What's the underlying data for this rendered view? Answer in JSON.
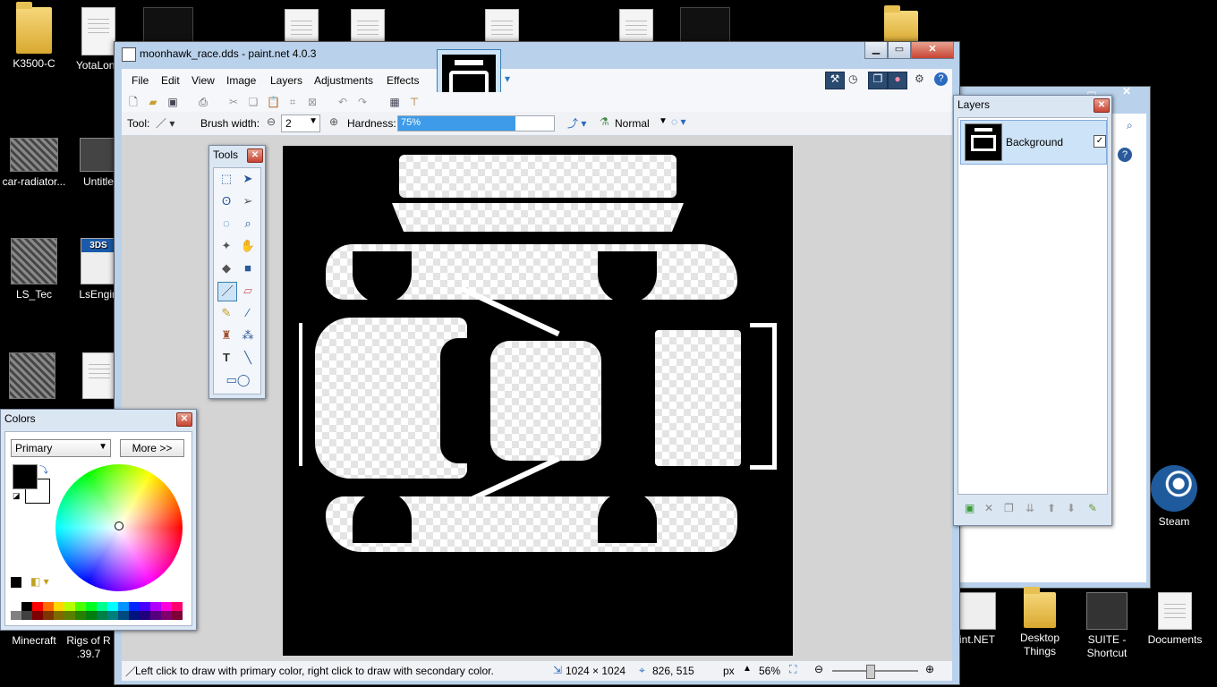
{
  "desktop": {
    "icons_left": [
      {
        "label": "K3500-C",
        "kind": "folder"
      },
      {
        "label": "YotaLong",
        "kind": "doc"
      },
      {
        "label": "car-radiator...",
        "kind": "thumb"
      },
      {
        "label": "Untitle",
        "kind": "imgicon"
      },
      {
        "label": "LS_Tec",
        "kind": "thumb"
      },
      {
        "label": "LsEngin",
        "kind": "3ds"
      },
      {
        "label": "Minecraft",
        "kind": "app"
      },
      {
        "label": "Rigs of R\n.39.7",
        "kind": "app"
      }
    ],
    "rigs_label_line1": "Rigs of R",
    "rigs_label_line2": ".39.7",
    "icons_right": [
      {
        "label": "Steam"
      },
      {
        "label": "int.NET"
      },
      {
        "label": "Desktop Things"
      },
      {
        "label": "SUITE - Shortcut"
      },
      {
        "label": "Documents"
      }
    ],
    "badge_3ds": "3DS"
  },
  "window": {
    "title": "moonhawk_race.dds - paint.net 4.0.3",
    "menu": [
      "File",
      "Edit",
      "View",
      "Image",
      "Layers",
      "Adjustments",
      "Effects"
    ],
    "tool_label": "Tool:",
    "brush_width_label": "Brush width:",
    "brush_width_value": "2",
    "hardness_label": "Hardness:",
    "hardness_value": "75%",
    "hardness_fraction": 0.75,
    "blend_mode": "Normal"
  },
  "status": {
    "hint": "Left click to draw with primary color, right click to draw with secondary color.",
    "image_size": "1024 × 1024",
    "cursor_pos": "826, 515",
    "unit": "px",
    "zoom": "56%"
  },
  "tools_panel": {
    "title": "Tools"
  },
  "colors_panel": {
    "title": "Colors",
    "mode": "Primary",
    "more_button": "More >>",
    "primary_color": "#000000",
    "secondary_color": "#ffffff"
  },
  "layers_panel": {
    "title": "Layers",
    "layers": [
      {
        "name": "Background",
        "visible": true
      }
    ]
  },
  "palette": [
    "#ffffff",
    "#000000",
    "#ff0000",
    "#ff6a00",
    "#ffd800",
    "#b6ff00",
    "#4cff00",
    "#00ff21",
    "#00ff90",
    "#00ffff",
    "#0094ff",
    "#0026ff",
    "#4800ff",
    "#b200ff",
    "#ff00dc",
    "#ff006e"
  ],
  "palette_dark": [
    "#808080",
    "#404040",
    "#7f0000",
    "#7f3300",
    "#7f6a00",
    "#5b7f00",
    "#267f00",
    "#007f0e",
    "#007f46",
    "#007f7f",
    "#004a7f",
    "#00137f",
    "#21007f",
    "#57007f",
    "#7f006e",
    "#7f0037"
  ]
}
